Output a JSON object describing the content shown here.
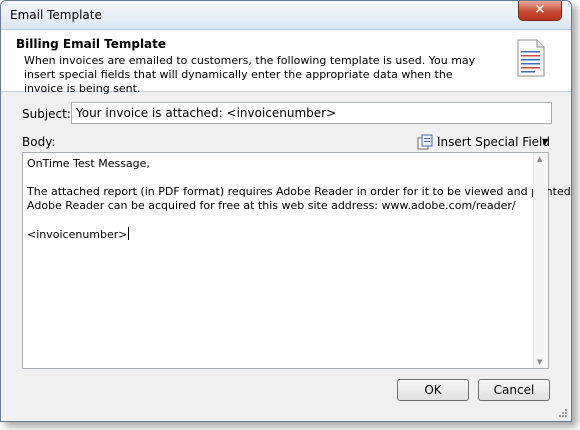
{
  "window": {
    "title": "Email Template",
    "close_glyph": "×"
  },
  "header": {
    "title": "Billing Email Template",
    "description": "When invoices are emailed to customers, the following template is used. You may insert special fields that will dynamically enter the appropriate data when the invoice is being sent.",
    "icon": "document-icon"
  },
  "subject": {
    "label": "Subject:",
    "value": "Your invoice is attached: <invoicenumber>"
  },
  "body": {
    "label": "Body:",
    "insert_field_label": "Insert Special Field",
    "text": "OnTime Test Message,\n\nThe attached report (in PDF format) requires Adobe Reader in order for it to be viewed and printed.\nAdobe Reader can be acquired for free at this web site address: www.adobe.com/reader/\n\n<invoicenumber>"
  },
  "buttons": {
    "ok": "OK",
    "cancel": "Cancel"
  },
  "colors": {
    "close_red": "#c74a33",
    "title_bar": "#dde7f2",
    "header_bg": "#ffffff",
    "dialog_bg": "#f0f0f0"
  }
}
